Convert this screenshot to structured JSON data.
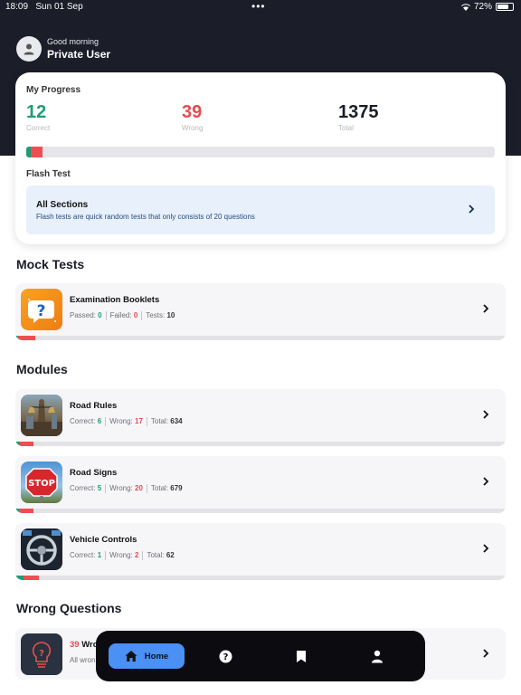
{
  "status_bar": {
    "time": "18:09",
    "date": "Sun 01 Sep",
    "battery": "72%",
    "battery_level": 0.72
  },
  "user": {
    "greeting": "Good morning",
    "name": "Private User"
  },
  "progress": {
    "title": "My Progress",
    "correct": {
      "value": "12",
      "label": "Correct"
    },
    "wrong": {
      "value": "39",
      "label": "Wrong"
    },
    "total": {
      "value": "1375",
      "label": "Total"
    },
    "correct_fraction": 0.009,
    "wrong_fraction": 0.026
  },
  "flash_test": {
    "title": "Flash Test",
    "box_title": "All Sections",
    "box_desc": "Flash tests are quick random tests that only consists of 20 questions"
  },
  "mock_tests": {
    "title": "Mock Tests",
    "items": [
      {
        "name": "Examination Booklets",
        "k1": "Passed:",
        "v1": "0",
        "k2": "Failed:",
        "v2": "0",
        "k3": "Tests:",
        "v3": "10",
        "icon": "question-bubble-icon",
        "correct_fraction": 0.004,
        "wrong_fraction": 0.036
      }
    ]
  },
  "modules": {
    "title": "Modules",
    "items": [
      {
        "name": "Road Rules",
        "k1": "Correct:",
        "v1": "6",
        "k2": "Wrong:",
        "v2": "17",
        "k3": "Total:",
        "v3": "634",
        "icon": "justice-statue-icon",
        "correct_fraction": 0.01,
        "wrong_fraction": 0.027
      },
      {
        "name": "Road Signs",
        "k1": "Correct:",
        "v1": "5",
        "k2": "Wrong:",
        "v2": "20",
        "k3": "Total:",
        "v3": "679",
        "icon": "stop-sign-icon",
        "correct_fraction": 0.008,
        "wrong_fraction": 0.029
      },
      {
        "name": "Vehicle Controls",
        "k1": "Correct:",
        "v1": "1",
        "k2": "Wrong:",
        "v2": "2",
        "k3": "Total:",
        "v3": "62",
        "icon": "steering-wheel-icon",
        "correct_fraction": 0.016,
        "wrong_fraction": 0.032
      }
    ]
  },
  "wrong_questions": {
    "title": "Wrong Questions",
    "count": "39",
    "label_fragment": "Wro",
    "sub_fragment": "All wron",
    "icon": "lightbulb-icon"
  },
  "tabbar": {
    "home_label": "Home",
    "tabs": [
      "home-icon",
      "help-icon",
      "bookmark-icon",
      "profile-icon"
    ]
  },
  "colors": {
    "header": "#1b1d29",
    "correct": "#1f9d73",
    "wrong": "#ee4e52",
    "accent": "#4a90f5"
  }
}
